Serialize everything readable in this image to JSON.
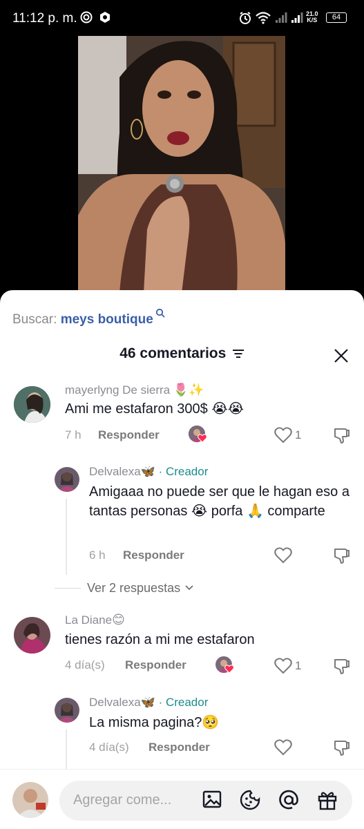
{
  "status_bar": {
    "time": "11:12 p. m.",
    "speed_value": "21.0",
    "speed_unit": "K/S",
    "battery": "64"
  },
  "search": {
    "prefix": "Buscar:",
    "term": "meys boutique"
  },
  "header": {
    "count_label": "46 comentarios"
  },
  "comments": [
    {
      "author": "mayerlyng De sierra",
      "author_emoji": "🌷✨",
      "text": "Ami me estafaron 300$ 😭😭",
      "time": "7 h",
      "reply_label": "Responder",
      "likes": "1"
    },
    {
      "author": "Delvalexa🦋",
      "creator_tag": "· Creador",
      "text": "Amigaaa no puede ser que le hagan eso a tantas personas 😭 porfa 🙏 comparte",
      "time": "6 h",
      "reply_label": "Responder"
    },
    {
      "view_more": "Ver 2 respuestas"
    },
    {
      "author": "La Diane",
      "author_emoji": "😊",
      "text": "tienes razón a mi me estafaron",
      "time": "4 día(s)",
      "reply_label": "Responder",
      "likes": "1"
    },
    {
      "author": "Delvalexa🦋",
      "creator_tag": "· Creador",
      "text": "La misma pagina?🥺",
      "time": "4 día(s)",
      "reply_label": "Responder"
    }
  ],
  "input": {
    "placeholder": "Agregar come..."
  },
  "colors": {
    "accent_search": "#3a5fa8",
    "creator": "#1e8c8c",
    "heart": "#fe2c55"
  }
}
